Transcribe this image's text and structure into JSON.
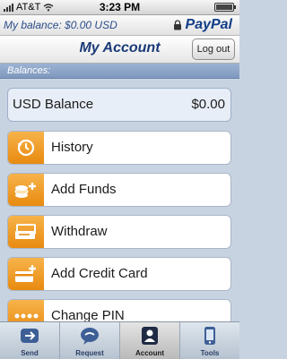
{
  "status": {
    "carrier": "AT&T",
    "time": "3:23 PM"
  },
  "balance_bar": {
    "balance_text": "My balance: $0.00 USD",
    "logo_text": "PayPal"
  },
  "nav": {
    "title": "My Account",
    "logout_label": "Log out"
  },
  "section": {
    "title": "Balances:"
  },
  "balance_row": {
    "label": "USD Balance",
    "value": "$0.00"
  },
  "menu": [
    {
      "label": "History",
      "icon": "clock-history-icon"
    },
    {
      "label": "Add Funds",
      "icon": "coins-plus-icon"
    },
    {
      "label": "Withdraw",
      "icon": "withdraw-money-icon"
    },
    {
      "label": "Add Credit Card",
      "icon": "credit-card-plus-icon"
    },
    {
      "label": "Change PIN",
      "icon": "pin-dots-icon"
    }
  ],
  "tabs": [
    {
      "label": "Send",
      "icon": "send-icon"
    },
    {
      "label": "Request",
      "icon": "request-icon"
    },
    {
      "label": "Account",
      "icon": "account-icon",
      "active": true
    },
    {
      "label": "Tools",
      "icon": "phone-tools-icon"
    }
  ],
  "colors": {
    "accent": "#1a3a78",
    "icon_orange": "#f0a030",
    "section_blue": "#8aa2c6"
  }
}
